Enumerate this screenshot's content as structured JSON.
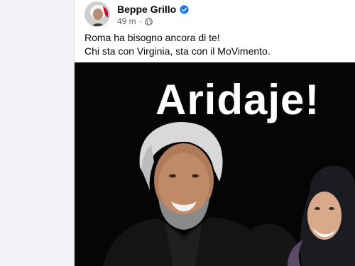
{
  "post": {
    "author_name": "Beppe Grillo",
    "verified_icon": "verified-badge-icon",
    "timestamp": "49 m",
    "separator": "·",
    "audience_icon": "globe-icon",
    "text_lines": [
      "Roma ha bisogno ancora di te!",
      "Chi sta con Virginia, sta con il MoVimento."
    ]
  },
  "media": {
    "headline": "Aridaje!",
    "description_icon": "photo-of-two-people-smiling"
  },
  "colors": {
    "page_bg": "#f0f2f5",
    "card_bg": "#ffffff",
    "verified_blue": "#1877f2",
    "meta_gray": "#65676b",
    "media_bg": "#050505"
  }
}
